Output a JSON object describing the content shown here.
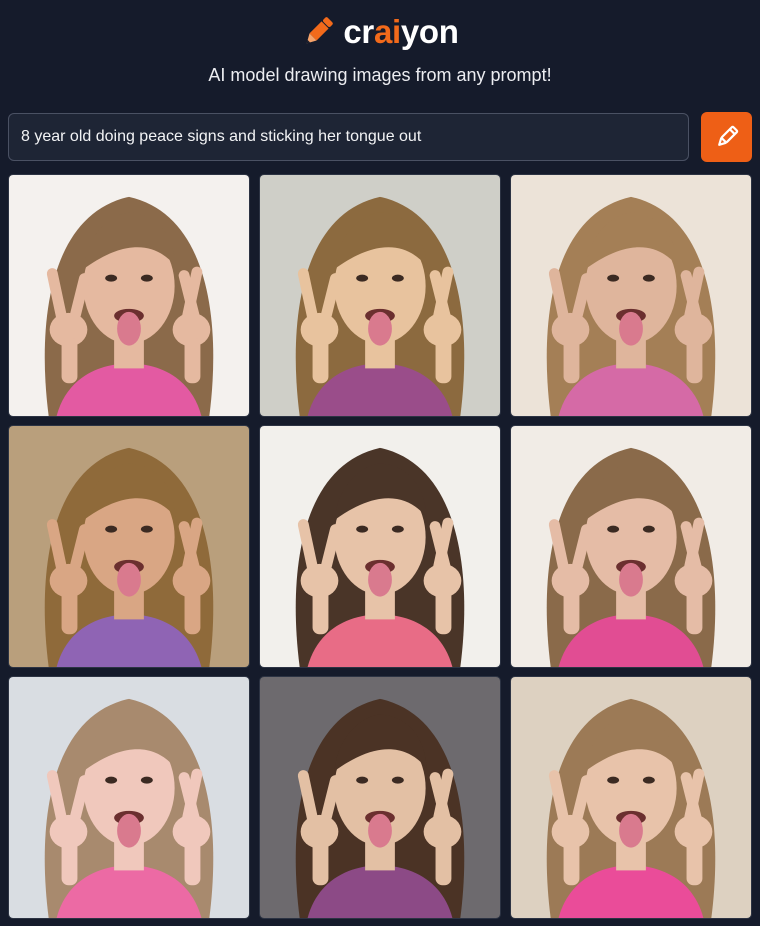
{
  "brand": {
    "name_prefix": "cr",
    "name_accent": "ai",
    "name_suffix": "yon",
    "accent_color": "#f26a1b",
    "logo_icon": "pencil-icon"
  },
  "tagline": "AI model drawing images from any prompt!",
  "prompt": {
    "value": "8 year old doing peace signs and sticking her tongue out"
  },
  "draw_button": {
    "icon": "pencil-icon",
    "color": "#ee5f16"
  },
  "results": [
    {
      "bg": "#f4f1ee",
      "hair": "#8b6a4a",
      "skin": "#e5b9a0",
      "shirt": "#e35aa2"
    },
    {
      "bg": "#cfcfc8",
      "hair": "#8c6a3f",
      "skin": "#e8c39e",
      "shirt": "#9a4d8a"
    },
    {
      "bg": "#ece3d8",
      "hair": "#a47f56",
      "skin": "#dfb59c",
      "shirt": "#d56aa6"
    },
    {
      "bg": "#b99f7c",
      "hair": "#8f6a3a",
      "skin": "#d9a684",
      "shirt": "#8f64b4"
    },
    {
      "bg": "#f2f0ec",
      "hair": "#4a3528",
      "skin": "#e7c3a8",
      "shirt": "#e86c86"
    },
    {
      "bg": "#f1ece6",
      "hair": "#8a6a4a",
      "skin": "#e5bca6",
      "shirt": "#e14d93"
    },
    {
      "bg": "#d9dde2",
      "hair": "#a88a6e",
      "skin": "#f0c8bc",
      "shirt": "#ec6aa4"
    },
    {
      "bg": "#6d6a6e",
      "hair": "#4b3325",
      "skin": "#e3c0a4",
      "shirt": "#8c4a86"
    },
    {
      "bg": "#ddd1c1",
      "hair": "#9c7a56",
      "skin": "#e8c3aa",
      "shirt": "#ea4c99"
    }
  ]
}
